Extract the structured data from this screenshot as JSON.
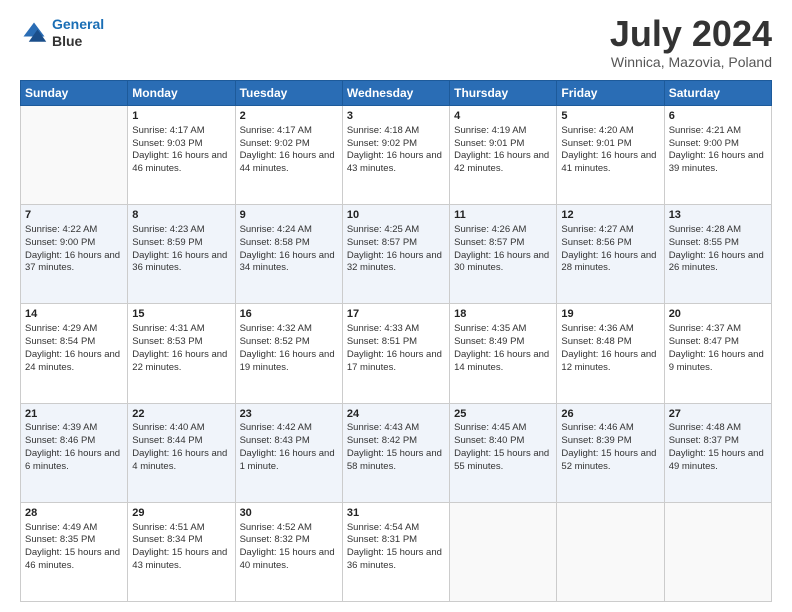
{
  "header": {
    "logo_line1": "General",
    "logo_line2": "Blue",
    "title": "July 2024",
    "subtitle": "Winnica, Mazovia, Poland"
  },
  "days_of_week": [
    "Sunday",
    "Monday",
    "Tuesday",
    "Wednesday",
    "Thursday",
    "Friday",
    "Saturday"
  ],
  "weeks": [
    [
      {
        "day": "",
        "sunrise": "",
        "sunset": "",
        "daylight": ""
      },
      {
        "day": "1",
        "sunrise": "Sunrise: 4:17 AM",
        "sunset": "Sunset: 9:03 PM",
        "daylight": "Daylight: 16 hours and 46 minutes."
      },
      {
        "day": "2",
        "sunrise": "Sunrise: 4:17 AM",
        "sunset": "Sunset: 9:02 PM",
        "daylight": "Daylight: 16 hours and 44 minutes."
      },
      {
        "day": "3",
        "sunrise": "Sunrise: 4:18 AM",
        "sunset": "Sunset: 9:02 PM",
        "daylight": "Daylight: 16 hours and 43 minutes."
      },
      {
        "day": "4",
        "sunrise": "Sunrise: 4:19 AM",
        "sunset": "Sunset: 9:01 PM",
        "daylight": "Daylight: 16 hours and 42 minutes."
      },
      {
        "day": "5",
        "sunrise": "Sunrise: 4:20 AM",
        "sunset": "Sunset: 9:01 PM",
        "daylight": "Daylight: 16 hours and 41 minutes."
      },
      {
        "day": "6",
        "sunrise": "Sunrise: 4:21 AM",
        "sunset": "Sunset: 9:00 PM",
        "daylight": "Daylight: 16 hours and 39 minutes."
      }
    ],
    [
      {
        "day": "7",
        "sunrise": "Sunrise: 4:22 AM",
        "sunset": "Sunset: 9:00 PM",
        "daylight": "Daylight: 16 hours and 37 minutes."
      },
      {
        "day": "8",
        "sunrise": "Sunrise: 4:23 AM",
        "sunset": "Sunset: 8:59 PM",
        "daylight": "Daylight: 16 hours and 36 minutes."
      },
      {
        "day": "9",
        "sunrise": "Sunrise: 4:24 AM",
        "sunset": "Sunset: 8:58 PM",
        "daylight": "Daylight: 16 hours and 34 minutes."
      },
      {
        "day": "10",
        "sunrise": "Sunrise: 4:25 AM",
        "sunset": "Sunset: 8:57 PM",
        "daylight": "Daylight: 16 hours and 32 minutes."
      },
      {
        "day": "11",
        "sunrise": "Sunrise: 4:26 AM",
        "sunset": "Sunset: 8:57 PM",
        "daylight": "Daylight: 16 hours and 30 minutes."
      },
      {
        "day": "12",
        "sunrise": "Sunrise: 4:27 AM",
        "sunset": "Sunset: 8:56 PM",
        "daylight": "Daylight: 16 hours and 28 minutes."
      },
      {
        "day": "13",
        "sunrise": "Sunrise: 4:28 AM",
        "sunset": "Sunset: 8:55 PM",
        "daylight": "Daylight: 16 hours and 26 minutes."
      }
    ],
    [
      {
        "day": "14",
        "sunrise": "Sunrise: 4:29 AM",
        "sunset": "Sunset: 8:54 PM",
        "daylight": "Daylight: 16 hours and 24 minutes."
      },
      {
        "day": "15",
        "sunrise": "Sunrise: 4:31 AM",
        "sunset": "Sunset: 8:53 PM",
        "daylight": "Daylight: 16 hours and 22 minutes."
      },
      {
        "day": "16",
        "sunrise": "Sunrise: 4:32 AM",
        "sunset": "Sunset: 8:52 PM",
        "daylight": "Daylight: 16 hours and 19 minutes."
      },
      {
        "day": "17",
        "sunrise": "Sunrise: 4:33 AM",
        "sunset": "Sunset: 8:51 PM",
        "daylight": "Daylight: 16 hours and 17 minutes."
      },
      {
        "day": "18",
        "sunrise": "Sunrise: 4:35 AM",
        "sunset": "Sunset: 8:49 PM",
        "daylight": "Daylight: 16 hours and 14 minutes."
      },
      {
        "day": "19",
        "sunrise": "Sunrise: 4:36 AM",
        "sunset": "Sunset: 8:48 PM",
        "daylight": "Daylight: 16 hours and 12 minutes."
      },
      {
        "day": "20",
        "sunrise": "Sunrise: 4:37 AM",
        "sunset": "Sunset: 8:47 PM",
        "daylight": "Daylight: 16 hours and 9 minutes."
      }
    ],
    [
      {
        "day": "21",
        "sunrise": "Sunrise: 4:39 AM",
        "sunset": "Sunset: 8:46 PM",
        "daylight": "Daylight: 16 hours and 6 minutes."
      },
      {
        "day": "22",
        "sunrise": "Sunrise: 4:40 AM",
        "sunset": "Sunset: 8:44 PM",
        "daylight": "Daylight: 16 hours and 4 minutes."
      },
      {
        "day": "23",
        "sunrise": "Sunrise: 4:42 AM",
        "sunset": "Sunset: 8:43 PM",
        "daylight": "Daylight: 16 hours and 1 minute."
      },
      {
        "day": "24",
        "sunrise": "Sunrise: 4:43 AM",
        "sunset": "Sunset: 8:42 PM",
        "daylight": "Daylight: 15 hours and 58 minutes."
      },
      {
        "day": "25",
        "sunrise": "Sunrise: 4:45 AM",
        "sunset": "Sunset: 8:40 PM",
        "daylight": "Daylight: 15 hours and 55 minutes."
      },
      {
        "day": "26",
        "sunrise": "Sunrise: 4:46 AM",
        "sunset": "Sunset: 8:39 PM",
        "daylight": "Daylight: 15 hours and 52 minutes."
      },
      {
        "day": "27",
        "sunrise": "Sunrise: 4:48 AM",
        "sunset": "Sunset: 8:37 PM",
        "daylight": "Daylight: 15 hours and 49 minutes."
      }
    ],
    [
      {
        "day": "28",
        "sunrise": "Sunrise: 4:49 AM",
        "sunset": "Sunset: 8:35 PM",
        "daylight": "Daylight: 15 hours and 46 minutes."
      },
      {
        "day": "29",
        "sunrise": "Sunrise: 4:51 AM",
        "sunset": "Sunset: 8:34 PM",
        "daylight": "Daylight: 15 hours and 43 minutes."
      },
      {
        "day": "30",
        "sunrise": "Sunrise: 4:52 AM",
        "sunset": "Sunset: 8:32 PM",
        "daylight": "Daylight: 15 hours and 40 minutes."
      },
      {
        "day": "31",
        "sunrise": "Sunrise: 4:54 AM",
        "sunset": "Sunset: 8:31 PM",
        "daylight": "Daylight: 15 hours and 36 minutes."
      },
      {
        "day": "",
        "sunrise": "",
        "sunset": "",
        "daylight": ""
      },
      {
        "day": "",
        "sunrise": "",
        "sunset": "",
        "daylight": ""
      },
      {
        "day": "",
        "sunrise": "",
        "sunset": "",
        "daylight": ""
      }
    ]
  ]
}
